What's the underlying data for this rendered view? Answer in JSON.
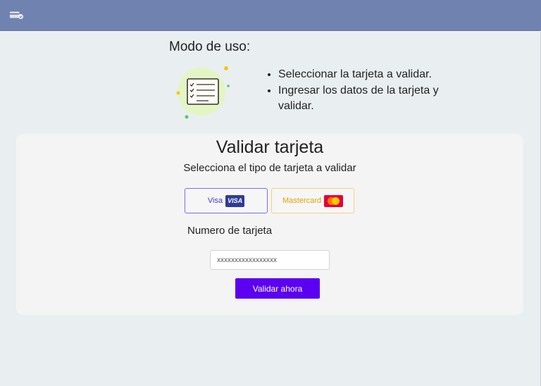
{
  "header": {
    "logo_icon": "card-check-logo-icon"
  },
  "instructions": {
    "title": "Modo de uso:",
    "icon": "checklist-icon",
    "steps": [
      {
        "text": "Seleccionar la tarjeta a validar."
      },
      {
        "text": "Ingresar los datos de la tarjeta y validar."
      }
    ]
  },
  "validator": {
    "title": "Validar tarjeta",
    "subtitle": "Selecciona el tipo de tarjeta a validar",
    "card_types": [
      {
        "label": "Visa",
        "logo_text": "VISA",
        "color": "#3b3bdc"
      },
      {
        "label": "Mastercard",
        "color": "#e0a400"
      }
    ],
    "number_label": "Numero de tarjeta",
    "number_placeholder": "xxxxxxxxxxxxxxxxx",
    "submit_label": "Validar ahora"
  },
  "colors": {
    "header": "#7083b0",
    "background": "#e9eef0",
    "panel": "#f4f4f4",
    "accent": "#5c00f2"
  }
}
